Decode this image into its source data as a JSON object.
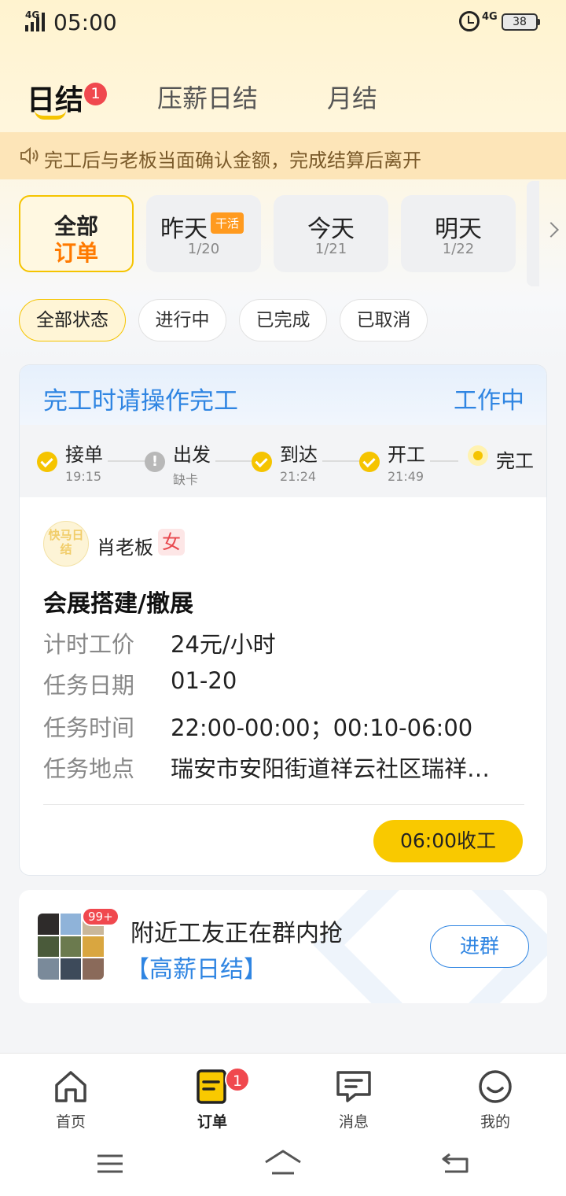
{
  "status_bar": {
    "network": "4G",
    "time": "05:00",
    "network2": "4G",
    "battery": "38"
  },
  "tabs": [
    {
      "label": "日结",
      "badge": "1"
    },
    {
      "label": "压薪日结"
    },
    {
      "label": "月结"
    }
  ],
  "notice": "完工后与老板当面确认金额，完成结算后离开",
  "date_filters": [
    {
      "line1": "全部",
      "line2": "订单"
    },
    {
      "line1": "昨天",
      "line2": "1/20",
      "tag": "干活"
    },
    {
      "line1": "今天",
      "line2": "1/21"
    },
    {
      "line1": "明天",
      "line2": "1/22"
    }
  ],
  "status_filters": [
    "全部状态",
    "进行中",
    "已完成",
    "已取消"
  ],
  "order": {
    "headline": "完工时请操作完工",
    "state": "工作中",
    "steps": [
      {
        "name": "接单",
        "sub": "19:15"
      },
      {
        "name": "出发",
        "sub": "缺卡"
      },
      {
        "name": "到达",
        "sub": "21:24"
      },
      {
        "name": "开工",
        "sub": "21:49"
      },
      {
        "name": "完工",
        "sub": ""
      }
    ],
    "warn_symbol": "!",
    "boss_logo_text": "快马日结",
    "boss_name": "肖老板",
    "boss_gender": "女",
    "job_title": "会展搭建/撤展",
    "rows": [
      {
        "key": "计时工价",
        "value": "24元/小时"
      },
      {
        "key": "任务日期",
        "value": "01-20"
      },
      {
        "key": "任务时间",
        "value": "22:00-00:00；00:10-06:00"
      },
      {
        "key": "任务地点",
        "value": "瑞安市安阳街道祥云社区瑞祥…"
      }
    ],
    "end_button": "06:00收工"
  },
  "group_banner": {
    "badge": "99+",
    "line1": "附近工友正在群内抢",
    "line2": "【高薪日结】",
    "button": "进群"
  },
  "bottom_nav": [
    {
      "label": "首页",
      "icon": "home-icon"
    },
    {
      "label": "订单",
      "icon": "order-icon",
      "badge": "1"
    },
    {
      "label": "消息",
      "icon": "message-icon"
    },
    {
      "label": "我的",
      "icon": "profile-icon"
    }
  ],
  "colors": {
    "accent_yellow": "#f5c400",
    "link_blue": "#2f85e2",
    "badge_red": "#f0484e",
    "orange": "#ff7a00"
  }
}
